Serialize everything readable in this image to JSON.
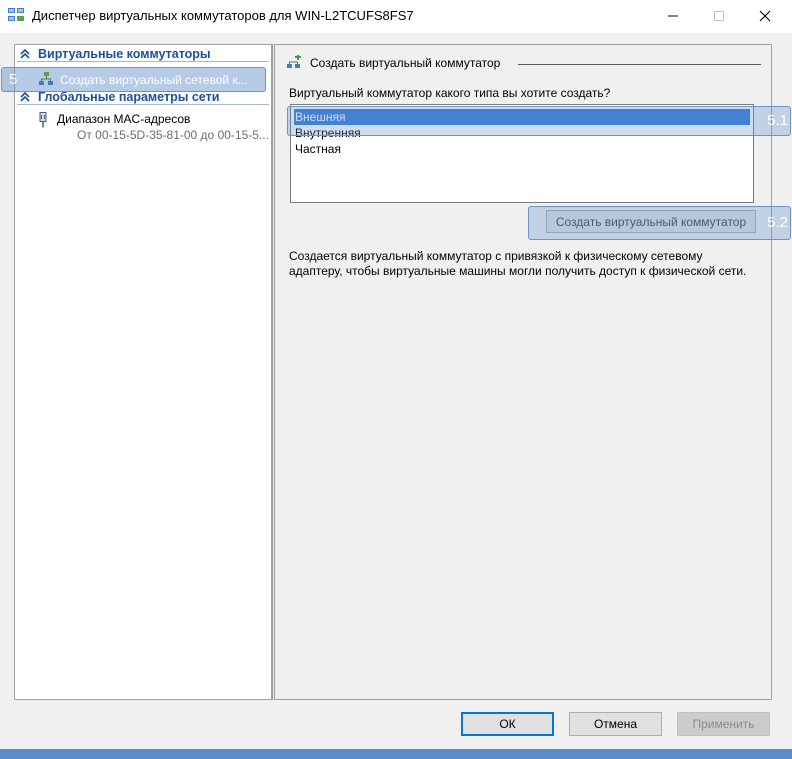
{
  "window": {
    "title": "Диспетчер виртуальных коммутаторов для WIN-L2TCUFS8FS7",
    "icon": "virtual-switch-manager-icon"
  },
  "left_pane": {
    "section1": {
      "title": "Виртуальные коммутаторы"
    },
    "selected_item": {
      "marker": "5",
      "label": "Создать виртуальный сетевой к...",
      "icon": "network-switch-icon"
    },
    "section2": {
      "title": "Глобальные параметры сети"
    },
    "mac_item": {
      "title": "Диапазон MAC-адресов",
      "range": "От 00-15-5D-35-81-00 до 00-15-5..."
    }
  },
  "right_pane": {
    "group_title": "Создать виртуальный коммутатор",
    "question": "Виртуальный коммутатор какого типа вы хотите создать?",
    "switch_types": [
      {
        "label": "Внешняя",
        "selected": true
      },
      {
        "label": "Внутренняя",
        "selected": false
      },
      {
        "label": "Частная",
        "selected": false
      }
    ],
    "marker_list": "5.1",
    "create_button": "Создать виртуальный коммутатор",
    "marker_button": "5.2",
    "description": "Создается виртуальный коммутатор с привязкой к физическому сетевому адаптеру, чтобы виртуальные машины могли получить доступ к физической сети."
  },
  "buttons": {
    "ok": "ОК",
    "cancel": "Отмена",
    "apply": "Применить"
  },
  "colors": {
    "accent": "#3b7dd8",
    "section_title": "#1f4ea1",
    "highlight_border": "#6c93c4"
  }
}
